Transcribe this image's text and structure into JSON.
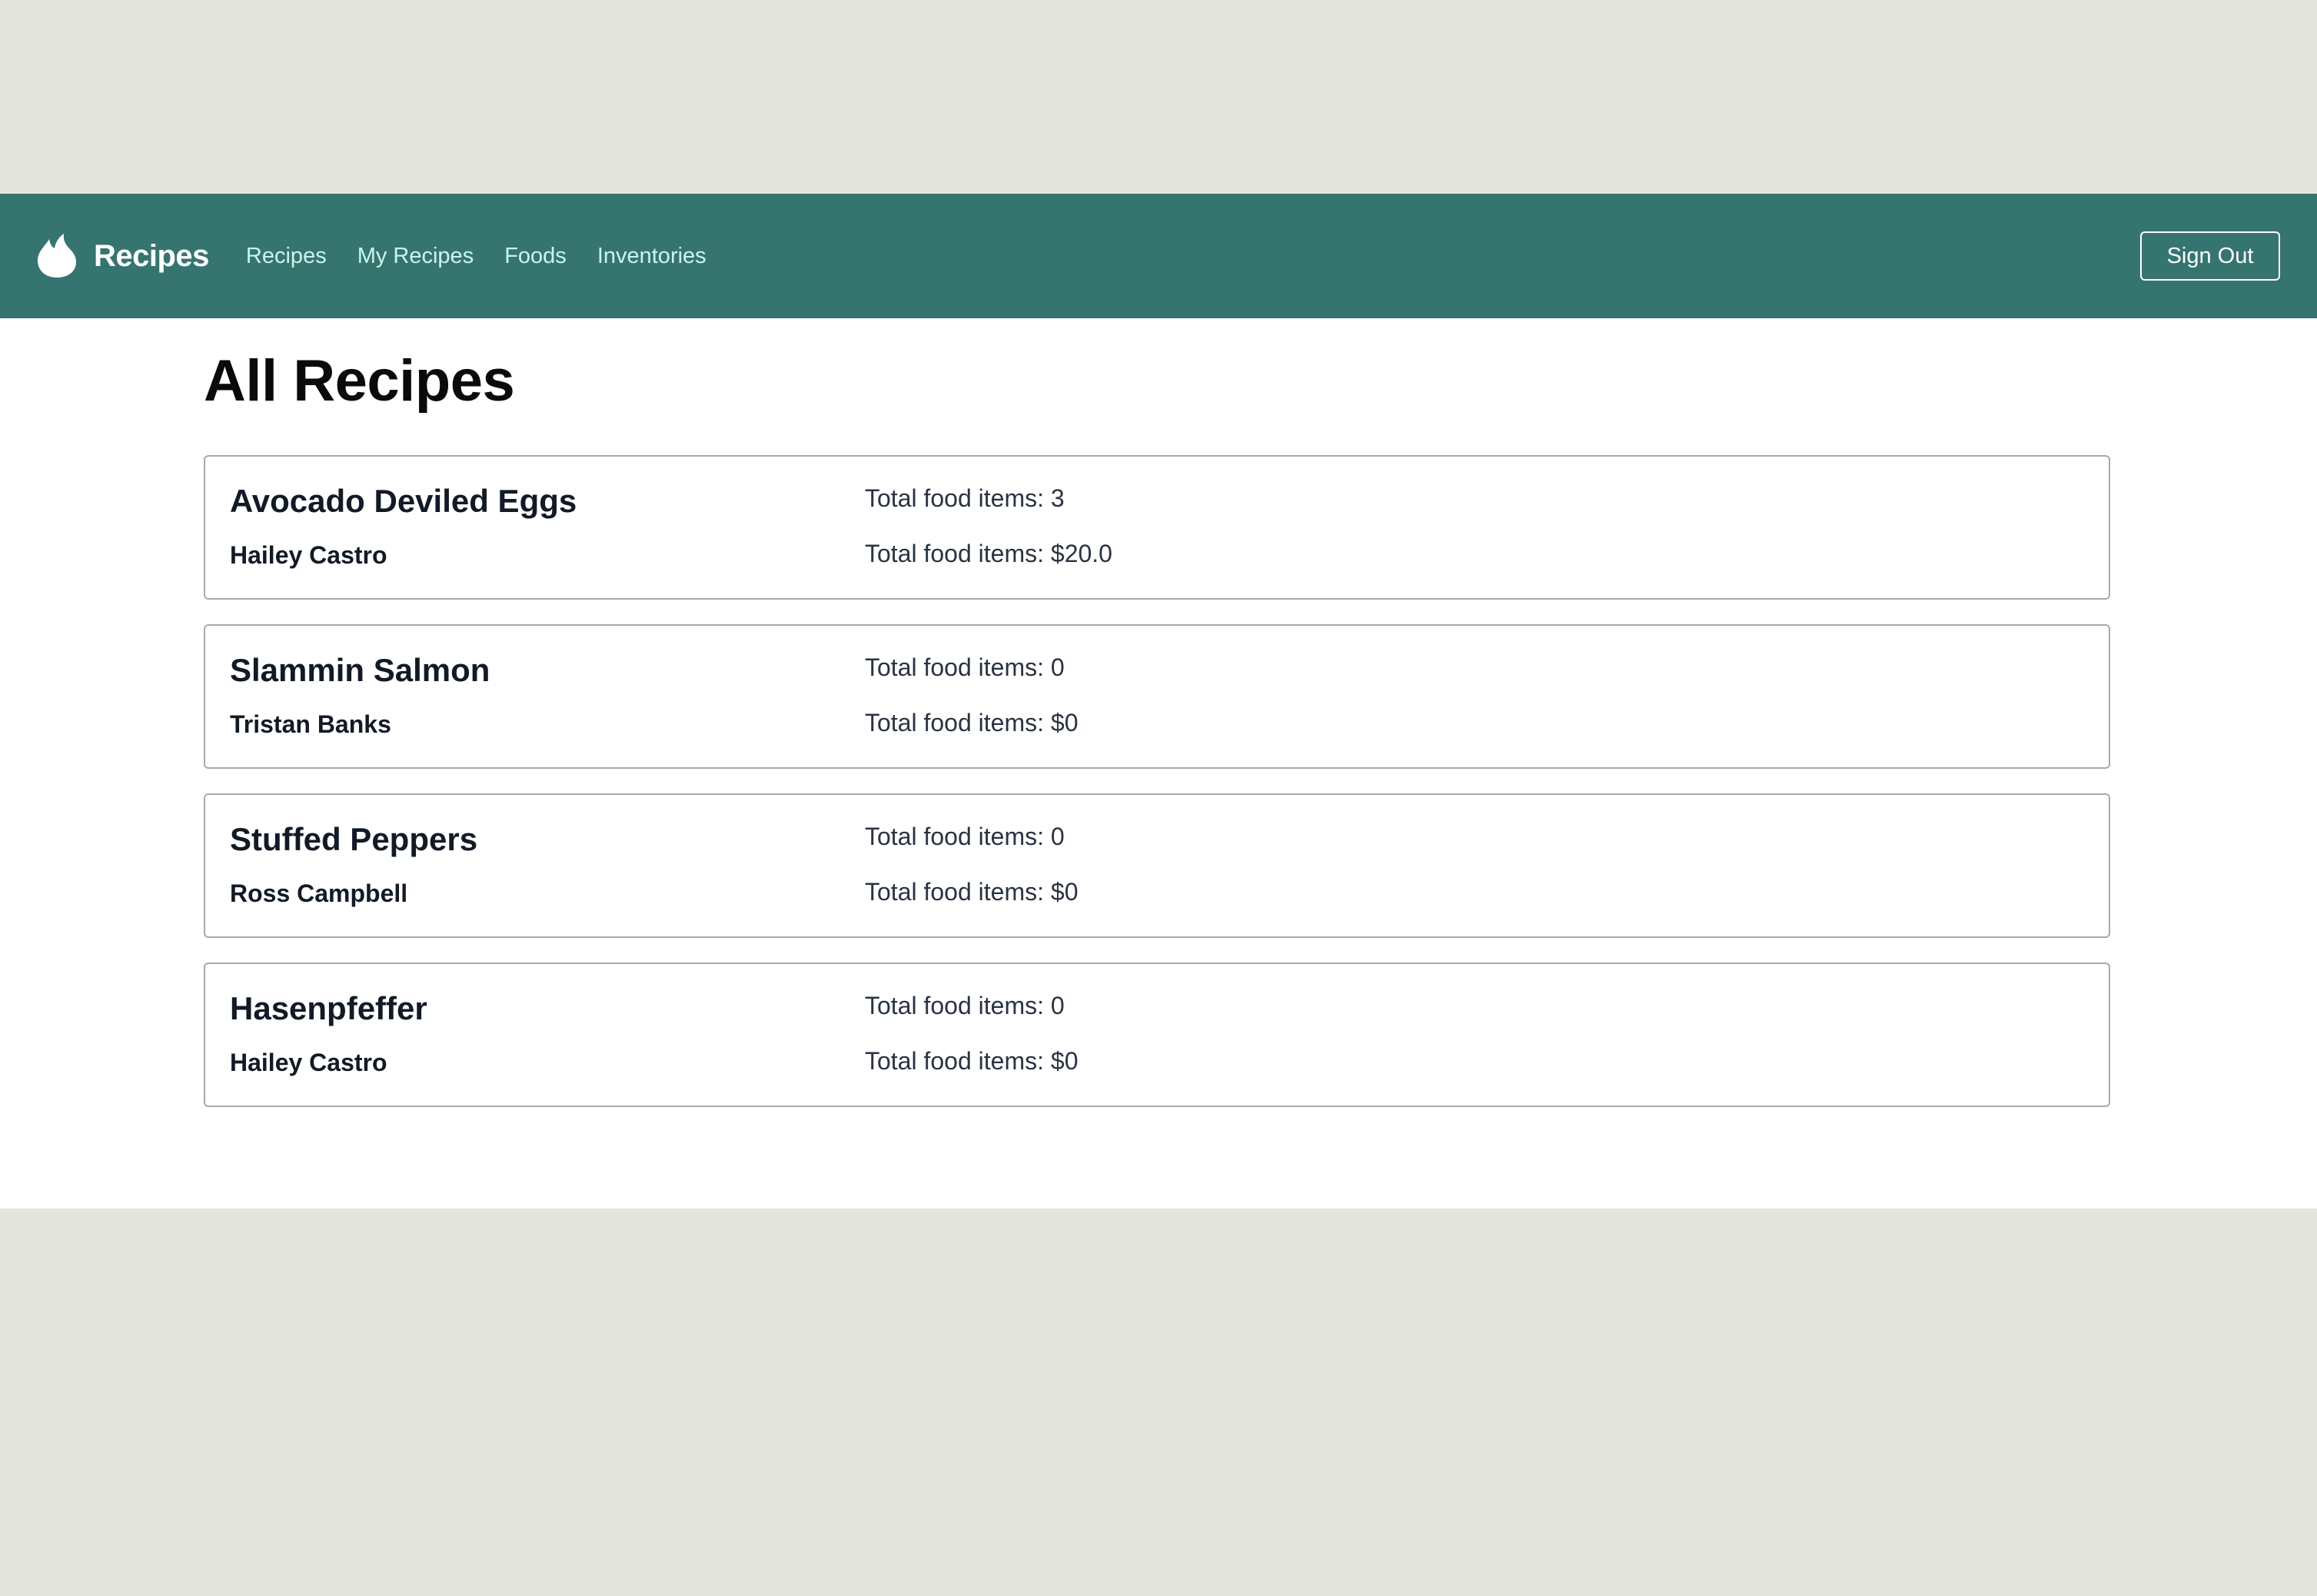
{
  "nav": {
    "brand": "Recipes",
    "brand_icon": "flame-icon",
    "links": [
      "Recipes",
      "My Recipes",
      "Foods",
      "Inventories"
    ],
    "signout_label": "Sign Out"
  },
  "colors": {
    "navbar": "#367470",
    "nav_link": "#c9f5ec",
    "page_bg": "#e5e5e0"
  },
  "page": {
    "title": "All Recipes"
  },
  "recipes": [
    {
      "name": "Avocado Deviled Eggs",
      "author": "Hailey Castro",
      "items_text": "Total food items: 3",
      "price_text": "Total food items: $20.0"
    },
    {
      "name": "Slammin Salmon",
      "author": "Tristan Banks",
      "items_text": "Total food items: 0",
      "price_text": "Total food items: $0"
    },
    {
      "name": "Stuffed Peppers",
      "author": "Ross Campbell",
      "items_text": "Total food items: 0",
      "price_text": "Total food items: $0"
    },
    {
      "name": "Hasenpfeffer",
      "author": "Hailey Castro",
      "items_text": "Total food items: 0",
      "price_text": "Total food items: $0"
    }
  ]
}
